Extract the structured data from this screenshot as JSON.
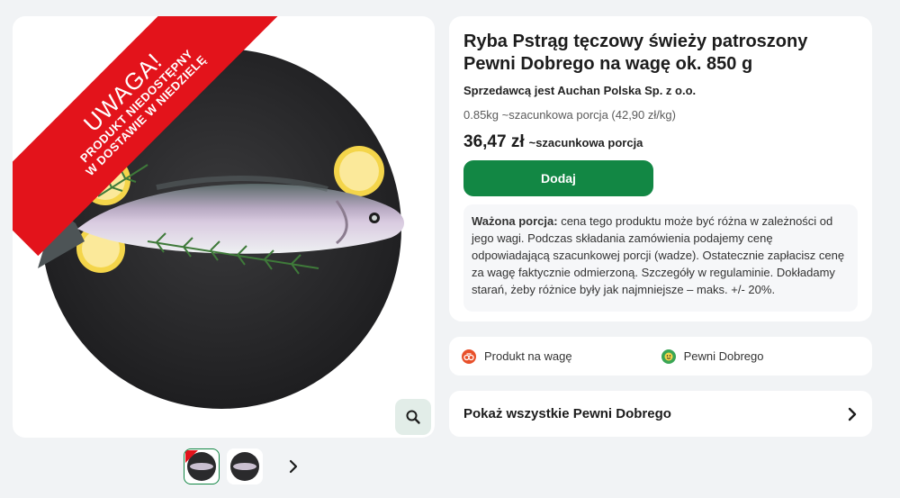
{
  "product": {
    "title": "Ryba Pstrąg tęczowy świeży patroszony Pewni Dobrego na wagę ok. 850 g",
    "seller": "Sprzedawcą jest Auchan Polska Sp. z o.o.",
    "portion_info": "0.85kg ~szacunkowa porcja (42,90 zł/kg)",
    "price": "36,47 zł",
    "price_note": "~szacunkowa porcja",
    "add_button": "Dodaj",
    "weighted_note_label": "Ważona porcja:",
    "weighted_note_text": " cena tego produktu może być różna w zależności od jego wagi. Podczas składania zamówienia podajemy cenę odpowiadającą szacunkowej porcji (wadze). Ostatecznie zapłacisz cenę za wagę faktycznie odmierzoną. Szczegóły w regulaminie. Dokładamy starań, żeby różnice były jak najmniejsze – maks. +/- 20%."
  },
  "banner": {
    "title": "UWAGA!",
    "line1": "PRODUKT NIEDOSTĘPNY",
    "line2": "W DOSTAWIE W NIEDZIELĘ"
  },
  "attributes": [
    {
      "label": "Produkt na wagę",
      "icon": "scale-icon",
      "color": "#e8502a"
    },
    {
      "label": "Pewni Dobrego",
      "icon": "pewni-dobrego-icon",
      "color": "#3aa655"
    }
  ],
  "show_all": {
    "label": "Pokaż wszystkie Pewni Dobrego"
  },
  "colors": {
    "accent": "#128744",
    "banner": "#e3131b"
  }
}
